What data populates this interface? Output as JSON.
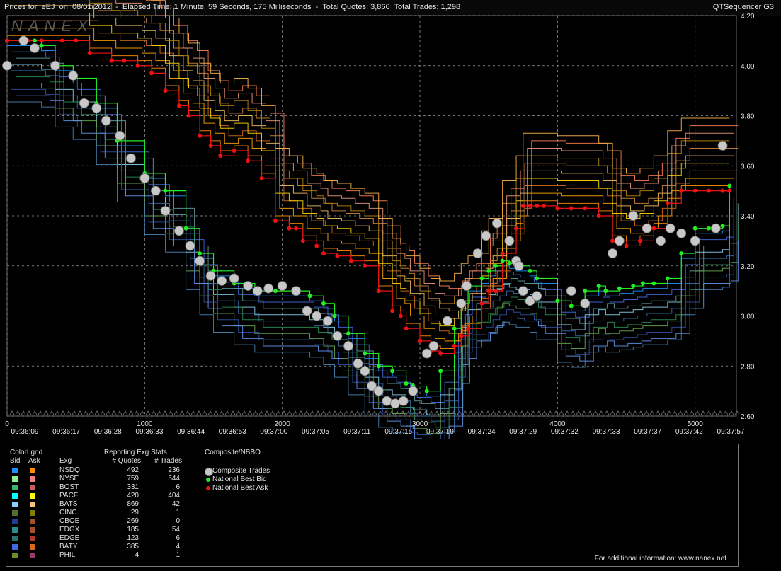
{
  "header": {
    "title": "Prices for  eEJ  on  08/01/2012  -  Elapsed Time: 1 Minute, 59 Seconds, 175 Milliseconds  -  Total Quotes: 3,866  Total Trades: 1,298",
    "app": "QTSequencer G3",
    "watermark": "NANEX"
  },
  "chart_data": {
    "type": "line",
    "y_axis": {
      "ticks": [
        "4.20",
        "4.00",
        "3.80",
        "3.60",
        "3.40",
        "3.20",
        "3.00",
        "2.80",
        "2.60"
      ],
      "range": [
        2.6,
        4.2
      ],
      "side": "right"
    },
    "x_axis": {
      "range": [
        0,
        5300
      ],
      "seq_ticks": [
        "0",
        "1000",
        "2000",
        "3000",
        "4000",
        "5000"
      ],
      "time_ticks": [
        "09:36:09",
        "09:36:17",
        "09:36:28",
        "09:36:33",
        "09:36:44",
        "09:36:53",
        "09:37:00",
        "09:37:05",
        "09:37:11",
        "09:37:15",
        "09:37:19",
        "09:37:24",
        "09:37:29",
        "09:37:32",
        "09:37:33",
        "09:37:37",
        "09:37:42",
        "09:37:57"
      ]
    },
    "grid": true,
    "colors": {
      "trade": "#c8c8c8",
      "bid": "#22ee22",
      "ask": "#ee1111",
      "bid_exchange_lines": [
        "#1e90ff",
        "#4169e1",
        "#5f9ea0",
        "#87ceeb",
        "#3a6ea5",
        "#2e8b57",
        "#6aa84f",
        "#2f4f9f",
        "#6495ed",
        "#4682b4"
      ],
      "ask_exchange_lines": [
        "#ff8c00",
        "#ffa500",
        "#d2691e",
        "#ffd700",
        "#f0c060",
        "#cd853f",
        "#b8860b",
        "#e9967a",
        "#ff7f50",
        "#ffb347"
      ]
    },
    "series": [
      {
        "name": "Composite Trades",
        "x": [
          0,
          120,
          200,
          350,
          480,
          560,
          650,
          720,
          820,
          900,
          1000,
          1080,
          1150,
          1250,
          1330,
          1400,
          1480,
          1560,
          1650,
          1750,
          1820,
          1900,
          2000,
          2100,
          2180,
          2250,
          2330,
          2400,
          2480,
          2550,
          2600,
          2650,
          2700,
          2760,
          2820,
          2880,
          2950,
          3050,
          3100,
          3200,
          3300,
          3340,
          3420,
          3480,
          3560,
          3650,
          3700,
          3720,
          3750,
          3800,
          3850,
          4100,
          4200,
          4400,
          4450,
          4550,
          4650,
          4750,
          4820,
          4900,
          5000,
          5150,
          5200
        ],
        "y": [
          4.0,
          4.1,
          4.07,
          4.0,
          3.96,
          3.85,
          3.83,
          3.78,
          3.72,
          3.63,
          3.55,
          3.5,
          3.42,
          3.34,
          3.28,
          3.22,
          3.16,
          3.14,
          3.15,
          3.12,
          3.1,
          3.11,
          3.12,
          3.1,
          3.02,
          3.0,
          2.98,
          2.92,
          2.88,
          2.81,
          2.78,
          2.72,
          2.7,
          2.66,
          2.65,
          2.66,
          2.7,
          2.85,
          2.88,
          2.98,
          3.05,
          3.12,
          3.25,
          3.32,
          3.37,
          3.3,
          3.22,
          3.2,
          3.1,
          3.06,
          3.08,
          3.1,
          3.05,
          3.25,
          3.3,
          3.4,
          3.35,
          3.3,
          3.35,
          3.33,
          3.3,
          3.35,
          3.68
        ]
      },
      {
        "name": "National Best Bid",
        "x": [
          0,
          200,
          250,
          350,
          480,
          650,
          800,
          1000,
          1150,
          1300,
          1400,
          1500,
          1650,
          1800,
          1950,
          2100,
          2200,
          2300,
          2380,
          2480,
          2600,
          2700,
          2800,
          2900,
          2950,
          3050,
          3150,
          3250,
          3300,
          3350,
          3450,
          3500,
          3550,
          3600,
          3650,
          3700,
          3800,
          3850,
          4000,
          4100,
          4200,
          4300,
          4350,
          4450,
          4550,
          4620,
          4700,
          4800,
          4900,
          5000,
          5100,
          5200,
          5250
        ],
        "y": [
          4.1,
          4.1,
          4.08,
          4.0,
          3.95,
          3.85,
          3.7,
          3.57,
          3.5,
          3.35,
          3.25,
          3.18,
          3.13,
          3.1,
          3.1,
          3.1,
          3.08,
          3.05,
          3.0,
          2.93,
          2.85,
          2.8,
          2.78,
          2.73,
          2.72,
          2.7,
          2.78,
          2.95,
          3.05,
          3.12,
          3.15,
          3.18,
          3.2,
          3.22,
          3.21,
          3.2,
          3.18,
          3.15,
          3.06,
          3.04,
          3.1,
          3.12,
          3.1,
          3.11,
          3.12,
          3.13,
          3.13,
          3.15,
          3.25,
          3.35,
          3.35,
          3.36,
          3.52
        ]
      },
      {
        "name": "National Best Ask",
        "x": [
          0,
          150,
          250,
          400,
          500,
          600,
          760,
          850,
          950,
          1050,
          1150,
          1250,
          1320,
          1400,
          1480,
          1550,
          1650,
          1750,
          1850,
          1950,
          2050,
          2100,
          2150,
          2250,
          2300,
          2400,
          2500,
          2600,
          2700,
          2800,
          2860,
          2900,
          3000,
          3080,
          3150,
          3250,
          3300,
          3350,
          3450,
          3500,
          3550,
          3600,
          3700,
          3750,
          3800,
          3850,
          3900,
          4000,
          4100,
          4200,
          4300,
          4400,
          4500,
          4600,
          4700,
          4800,
          4900,
          5000,
          5100,
          5200,
          5250
        ],
        "y": [
          4.1,
          4.1,
          4.1,
          4.1,
          4.1,
          4.05,
          4.02,
          4.02,
          4.0,
          3.97,
          3.9,
          3.84,
          3.8,
          3.72,
          3.68,
          3.64,
          3.66,
          3.62,
          3.55,
          3.38,
          3.35,
          3.35,
          3.3,
          3.28,
          3.25,
          3.24,
          3.22,
          3.2,
          3.1,
          3.02,
          3.0,
          2.95,
          2.9,
          2.86,
          2.85,
          2.88,
          2.92,
          2.95,
          3.05,
          3.1,
          3.1,
          3.25,
          3.35,
          3.44,
          3.44,
          3.44,
          3.44,
          3.43,
          3.43,
          3.43,
          3.4,
          3.3,
          3.28,
          3.3,
          3.35,
          3.45,
          3.5,
          3.5,
          3.5,
          3.5,
          3.5
        ]
      }
    ]
  },
  "stats_panel": {
    "heading_colorlgnd": "ColorLgnd",
    "heading_bid": "Bid",
    "heading_ask": "Ask",
    "heading_exg": "Exg",
    "heading_reporting": "Reporting Exg Stats",
    "heading_quotes": "# Quotes",
    "heading_trades": "# Trades",
    "heading_composite": "Composite/NBBO",
    "rows": [
      {
        "exg": "NSDQ",
        "quotes": "492",
        "trades": "236",
        "bid_color": "#1e90ff",
        "ask_color": "#ff8c00"
      },
      {
        "exg": "NYSE",
        "quotes": "759",
        "trades": "544",
        "bid_color": "#90ee90",
        "ask_color": "#f08080"
      },
      {
        "exg": "BOST",
        "quotes": "331",
        "trades": "6",
        "bid_color": "#3cb371",
        "ask_color": "#cd5c5c"
      },
      {
        "exg": "PACF",
        "quotes": "420",
        "trades": "404",
        "bid_color": "#00ffff",
        "ask_color": "#ffff00"
      },
      {
        "exg": "BATS",
        "quotes": "869",
        "trades": "42",
        "bid_color": "#87cefa",
        "ask_color": "#f4c27a"
      },
      {
        "exg": "CINC",
        "quotes": "29",
        "trades": "1",
        "bid_color": "#556b2f",
        "ask_color": "#808000"
      },
      {
        "exg": "CBOE",
        "quotes": "269",
        "trades": "0",
        "bid_color": "#1c3f8f",
        "ask_color": "#a0522d"
      },
      {
        "exg": "EDGX",
        "quotes": "185",
        "trades": "54",
        "bid_color": "#2e8b8b",
        "ask_color": "#a0522d"
      },
      {
        "exg": "EDGE",
        "quotes": "123",
        "trades": "6",
        "bid_color": "#2f6f6f",
        "ask_color": "#b03a2e"
      },
      {
        "exg": "BATY",
        "quotes": "385",
        "trades": "4",
        "bid_color": "#4169e1",
        "ask_color": "#d2691e"
      },
      {
        "exg": "PHIL",
        "quotes": "4",
        "trades": "1",
        "bid_color": "#6b8e23",
        "ask_color": "#9b3a6a"
      }
    ],
    "legend": [
      {
        "label": "Composite Trades",
        "color": "#c8c8c8"
      },
      {
        "label": "National Best Bid",
        "color": "#22ee22"
      },
      {
        "label": "National Best Ask",
        "color": "#ee1111"
      }
    ],
    "footer": "For additional information: www.nanex.net"
  }
}
